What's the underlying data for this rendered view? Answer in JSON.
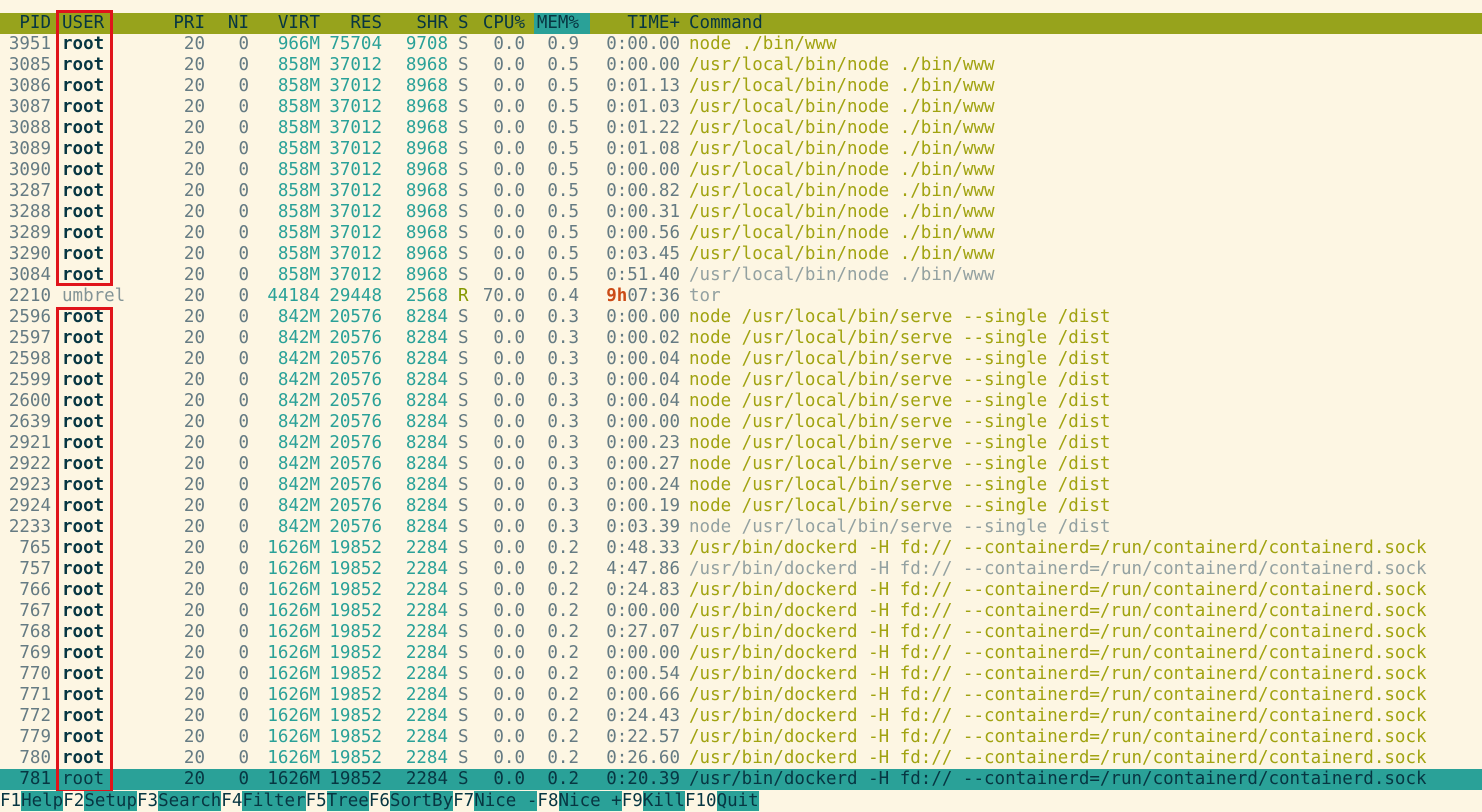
{
  "header": {
    "pid": "PID",
    "user": "USER",
    "pri": "PRI",
    "ni": "NI",
    "virt": "VIRT",
    "res": "RES",
    "shr": "SHR",
    "s": "S",
    "cpu": "CPU%",
    "mem": "MEM%",
    "time": "TIME+",
    "cmd": "Command"
  },
  "processes": [
    {
      "pid": "3951",
      "user": "root",
      "pri": "20",
      "ni": "0",
      "virt": "966M",
      "res": "75704",
      "shr": "9708",
      "s": "S",
      "cpu": "0.0",
      "mem": "0.9",
      "time": "0:00.00",
      "cmd": "node ./bin/www",
      "thread": false
    },
    {
      "pid": "3085",
      "user": "root",
      "pri": "20",
      "ni": "0",
      "virt": "858M",
      "res": "37012",
      "shr": "8968",
      "s": "S",
      "cpu": "0.0",
      "mem": "0.5",
      "time": "0:00.00",
      "cmd": "/usr/local/bin/node ./bin/www",
      "thread": false
    },
    {
      "pid": "3086",
      "user": "root",
      "pri": "20",
      "ni": "0",
      "virt": "858M",
      "res": "37012",
      "shr": "8968",
      "s": "S",
      "cpu": "0.0",
      "mem": "0.5",
      "time": "0:01.13",
      "cmd": "/usr/local/bin/node ./bin/www",
      "thread": false
    },
    {
      "pid": "3087",
      "user": "root",
      "pri": "20",
      "ni": "0",
      "virt": "858M",
      "res": "37012",
      "shr": "8968",
      "s": "S",
      "cpu": "0.0",
      "mem": "0.5",
      "time": "0:01.03",
      "cmd": "/usr/local/bin/node ./bin/www",
      "thread": false
    },
    {
      "pid": "3088",
      "user": "root",
      "pri": "20",
      "ni": "0",
      "virt": "858M",
      "res": "37012",
      "shr": "8968",
      "s": "S",
      "cpu": "0.0",
      "mem": "0.5",
      "time": "0:01.22",
      "cmd": "/usr/local/bin/node ./bin/www",
      "thread": false
    },
    {
      "pid": "3089",
      "user": "root",
      "pri": "20",
      "ni": "0",
      "virt": "858M",
      "res": "37012",
      "shr": "8968",
      "s": "S",
      "cpu": "0.0",
      "mem": "0.5",
      "time": "0:01.08",
      "cmd": "/usr/local/bin/node ./bin/www",
      "thread": false
    },
    {
      "pid": "3090",
      "user": "root",
      "pri": "20",
      "ni": "0",
      "virt": "858M",
      "res": "37012",
      "shr": "8968",
      "s": "S",
      "cpu": "0.0",
      "mem": "0.5",
      "time": "0:00.00",
      "cmd": "/usr/local/bin/node ./bin/www",
      "thread": false
    },
    {
      "pid": "3287",
      "user": "root",
      "pri": "20",
      "ni": "0",
      "virt": "858M",
      "res": "37012",
      "shr": "8968",
      "s": "S",
      "cpu": "0.0",
      "mem": "0.5",
      "time": "0:00.82",
      "cmd": "/usr/local/bin/node ./bin/www",
      "thread": false
    },
    {
      "pid": "3288",
      "user": "root",
      "pri": "20",
      "ni": "0",
      "virt": "858M",
      "res": "37012",
      "shr": "8968",
      "s": "S",
      "cpu": "0.0",
      "mem": "0.5",
      "time": "0:00.31",
      "cmd": "/usr/local/bin/node ./bin/www",
      "thread": false
    },
    {
      "pid": "3289",
      "user": "root",
      "pri": "20",
      "ni": "0",
      "virt": "858M",
      "res": "37012",
      "shr": "8968",
      "s": "S",
      "cpu": "0.0",
      "mem": "0.5",
      "time": "0:00.56",
      "cmd": "/usr/local/bin/node ./bin/www",
      "thread": false
    },
    {
      "pid": "3290",
      "user": "root",
      "pri": "20",
      "ni": "0",
      "virt": "858M",
      "res": "37012",
      "shr": "8968",
      "s": "S",
      "cpu": "0.0",
      "mem": "0.5",
      "time": "0:03.45",
      "cmd": "/usr/local/bin/node ./bin/www",
      "thread": false
    },
    {
      "pid": "3084",
      "user": "root",
      "pri": "20",
      "ni": "0",
      "virt": "858M",
      "res": "37012",
      "shr": "8968",
      "s": "S",
      "cpu": "0.0",
      "mem": "0.5",
      "time": "0:51.40",
      "cmd": "/usr/local/bin/node ./bin/www",
      "thread": true
    },
    {
      "pid": "2210",
      "user": "umbrel",
      "pri": "20",
      "ni": "0",
      "virt": "44184",
      "res": "29448",
      "shr": "2568",
      "s": "R",
      "cpu": "70.0",
      "mem": "0.4",
      "time_hours": "9h",
      "time": "07:36",
      "cmd": "tor",
      "thread": true
    },
    {
      "pid": "2596",
      "user": "root",
      "pri": "20",
      "ni": "0",
      "virt": "842M",
      "res": "20576",
      "shr": "8284",
      "s": "S",
      "cpu": "0.0",
      "mem": "0.3",
      "time": "0:00.00",
      "cmd": "node /usr/local/bin/serve --single /dist",
      "thread": false
    },
    {
      "pid": "2597",
      "user": "root",
      "pri": "20",
      "ni": "0",
      "virt": "842M",
      "res": "20576",
      "shr": "8284",
      "s": "S",
      "cpu": "0.0",
      "mem": "0.3",
      "time": "0:00.02",
      "cmd": "node /usr/local/bin/serve --single /dist",
      "thread": false
    },
    {
      "pid": "2598",
      "user": "root",
      "pri": "20",
      "ni": "0",
      "virt": "842M",
      "res": "20576",
      "shr": "8284",
      "s": "S",
      "cpu": "0.0",
      "mem": "0.3",
      "time": "0:00.04",
      "cmd": "node /usr/local/bin/serve --single /dist",
      "thread": false
    },
    {
      "pid": "2599",
      "user": "root",
      "pri": "20",
      "ni": "0",
      "virt": "842M",
      "res": "20576",
      "shr": "8284",
      "s": "S",
      "cpu": "0.0",
      "mem": "0.3",
      "time": "0:00.04",
      "cmd": "node /usr/local/bin/serve --single /dist",
      "thread": false
    },
    {
      "pid": "2600",
      "user": "root",
      "pri": "20",
      "ni": "0",
      "virt": "842M",
      "res": "20576",
      "shr": "8284",
      "s": "S",
      "cpu": "0.0",
      "mem": "0.3",
      "time": "0:00.04",
      "cmd": "node /usr/local/bin/serve --single /dist",
      "thread": false
    },
    {
      "pid": "2639",
      "user": "root",
      "pri": "20",
      "ni": "0",
      "virt": "842M",
      "res": "20576",
      "shr": "8284",
      "s": "S",
      "cpu": "0.0",
      "mem": "0.3",
      "time": "0:00.00",
      "cmd": "node /usr/local/bin/serve --single /dist",
      "thread": false
    },
    {
      "pid": "2921",
      "user": "root",
      "pri": "20",
      "ni": "0",
      "virt": "842M",
      "res": "20576",
      "shr": "8284",
      "s": "S",
      "cpu": "0.0",
      "mem": "0.3",
      "time": "0:00.23",
      "cmd": "node /usr/local/bin/serve --single /dist",
      "thread": false
    },
    {
      "pid": "2922",
      "user": "root",
      "pri": "20",
      "ni": "0",
      "virt": "842M",
      "res": "20576",
      "shr": "8284",
      "s": "S",
      "cpu": "0.0",
      "mem": "0.3",
      "time": "0:00.27",
      "cmd": "node /usr/local/bin/serve --single /dist",
      "thread": false
    },
    {
      "pid": "2923",
      "user": "root",
      "pri": "20",
      "ni": "0",
      "virt": "842M",
      "res": "20576",
      "shr": "8284",
      "s": "S",
      "cpu": "0.0",
      "mem": "0.3",
      "time": "0:00.24",
      "cmd": "node /usr/local/bin/serve --single /dist",
      "thread": false
    },
    {
      "pid": "2924",
      "user": "root",
      "pri": "20",
      "ni": "0",
      "virt": "842M",
      "res": "20576",
      "shr": "8284",
      "s": "S",
      "cpu": "0.0",
      "mem": "0.3",
      "time": "0:00.19",
      "cmd": "node /usr/local/bin/serve --single /dist",
      "thread": false
    },
    {
      "pid": "2233",
      "user": "root",
      "pri": "20",
      "ni": "0",
      "virt": "842M",
      "res": "20576",
      "shr": "8284",
      "s": "S",
      "cpu": "0.0",
      "mem": "0.3",
      "time": "0:03.39",
      "cmd": "node /usr/local/bin/serve --single /dist",
      "thread": true
    },
    {
      "pid": "765",
      "user": "root",
      "pri": "20",
      "ni": "0",
      "virt": "1626M",
      "res": "19852",
      "shr": "2284",
      "s": "S",
      "cpu": "0.0",
      "mem": "0.2",
      "time": "0:48.33",
      "cmd": "/usr/bin/dockerd -H fd:// --containerd=/run/containerd/containerd.sock",
      "thread": false
    },
    {
      "pid": "757",
      "user": "root",
      "pri": "20",
      "ni": "0",
      "virt": "1626M",
      "res": "19852",
      "shr": "2284",
      "s": "S",
      "cpu": "0.0",
      "mem": "0.2",
      "time": "4:47.86",
      "cmd": "/usr/bin/dockerd -H fd:// --containerd=/run/containerd/containerd.sock",
      "thread": true
    },
    {
      "pid": "766",
      "user": "root",
      "pri": "20",
      "ni": "0",
      "virt": "1626M",
      "res": "19852",
      "shr": "2284",
      "s": "S",
      "cpu": "0.0",
      "mem": "0.2",
      "time": "0:24.83",
      "cmd": "/usr/bin/dockerd -H fd:// --containerd=/run/containerd/containerd.sock",
      "thread": false
    },
    {
      "pid": "767",
      "user": "root",
      "pri": "20",
      "ni": "0",
      "virt": "1626M",
      "res": "19852",
      "shr": "2284",
      "s": "S",
      "cpu": "0.0",
      "mem": "0.2",
      "time": "0:00.00",
      "cmd": "/usr/bin/dockerd -H fd:// --containerd=/run/containerd/containerd.sock",
      "thread": false
    },
    {
      "pid": "768",
      "user": "root",
      "pri": "20",
      "ni": "0",
      "virt": "1626M",
      "res": "19852",
      "shr": "2284",
      "s": "S",
      "cpu": "0.0",
      "mem": "0.2",
      "time": "0:27.07",
      "cmd": "/usr/bin/dockerd -H fd:// --containerd=/run/containerd/containerd.sock",
      "thread": false
    },
    {
      "pid": "769",
      "user": "root",
      "pri": "20",
      "ni": "0",
      "virt": "1626M",
      "res": "19852",
      "shr": "2284",
      "s": "S",
      "cpu": "0.0",
      "mem": "0.2",
      "time": "0:00.00",
      "cmd": "/usr/bin/dockerd -H fd:// --containerd=/run/containerd/containerd.sock",
      "thread": false
    },
    {
      "pid": "770",
      "user": "root",
      "pri": "20",
      "ni": "0",
      "virt": "1626M",
      "res": "19852",
      "shr": "2284",
      "s": "S",
      "cpu": "0.0",
      "mem": "0.2",
      "time": "0:00.54",
      "cmd": "/usr/bin/dockerd -H fd:// --containerd=/run/containerd/containerd.sock",
      "thread": false
    },
    {
      "pid": "771",
      "user": "root",
      "pri": "20",
      "ni": "0",
      "virt": "1626M",
      "res": "19852",
      "shr": "2284",
      "s": "S",
      "cpu": "0.0",
      "mem": "0.2",
      "time": "0:00.66",
      "cmd": "/usr/bin/dockerd -H fd:// --containerd=/run/containerd/containerd.sock",
      "thread": false
    },
    {
      "pid": "772",
      "user": "root",
      "pri": "20",
      "ni": "0",
      "virt": "1626M",
      "res": "19852",
      "shr": "2284",
      "s": "S",
      "cpu": "0.0",
      "mem": "0.2",
      "time": "0:24.43",
      "cmd": "/usr/bin/dockerd -H fd:// --containerd=/run/containerd/containerd.sock",
      "thread": false
    },
    {
      "pid": "779",
      "user": "root",
      "pri": "20",
      "ni": "0",
      "virt": "1626M",
      "res": "19852",
      "shr": "2284",
      "s": "S",
      "cpu": "0.0",
      "mem": "0.2",
      "time": "0:22.57",
      "cmd": "/usr/bin/dockerd -H fd:// --containerd=/run/containerd/containerd.sock",
      "thread": false
    },
    {
      "pid": "780",
      "user": "root",
      "pri": "20",
      "ni": "0",
      "virt": "1626M",
      "res": "19852",
      "shr": "2284",
      "s": "S",
      "cpu": "0.0",
      "mem": "0.2",
      "time": "0:26.60",
      "cmd": "/usr/bin/dockerd -H fd:// --containerd=/run/containerd/containerd.sock",
      "thread": false
    },
    {
      "pid": "781",
      "user": "root",
      "pri": "20",
      "ni": "0",
      "virt": "1626M",
      "res": "19852",
      "shr": "2284",
      "s": "S",
      "cpu": "0.0",
      "mem": "0.2",
      "time": "0:20.39",
      "cmd": "/usr/bin/dockerd -H fd:// --containerd=/run/containerd/containerd.sock",
      "thread": false,
      "selected": true
    }
  ],
  "function_bar": [
    {
      "key": "F1",
      "label": "Help"
    },
    {
      "key": "F2",
      "label": "Setup"
    },
    {
      "key": "F3",
      "label": "Search"
    },
    {
      "key": "F4",
      "label": "Filter"
    },
    {
      "key": "F5",
      "label": "Tree"
    },
    {
      "key": "F6",
      "label": "SortBy"
    },
    {
      "key": "F7",
      "label": "Nice -"
    },
    {
      "key": "F8",
      "label": "Nice +"
    },
    {
      "key": "F9",
      "label": "Kill"
    },
    {
      "key": "F10",
      "label": "Quit"
    }
  ],
  "colors": {
    "background": "#fdf6e3",
    "header_bg": "#97a31c",
    "selected_bg": "#2aa198",
    "annotation": "#e0141b"
  }
}
